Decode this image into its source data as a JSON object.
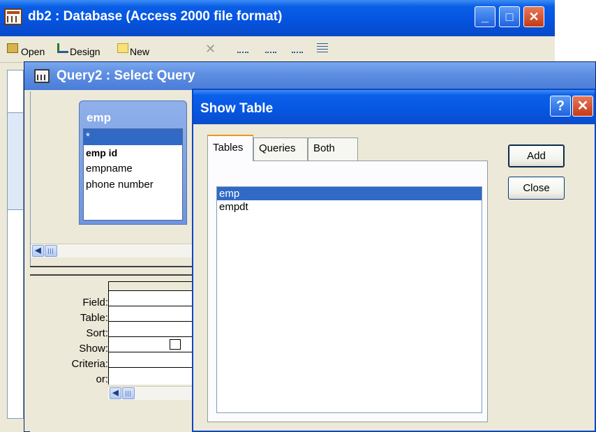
{
  "db_window": {
    "title": "db2 : Database (Access 2000 file format)",
    "toolbar": {
      "open_label": "Open",
      "design_label": "Design",
      "new_label": "New"
    }
  },
  "query_window": {
    "title": "Query2 : Select Query",
    "field_list": {
      "title": "emp",
      "fields": [
        "*",
        "emp id",
        "empname",
        "phone number"
      ]
    },
    "grid_rows": [
      "Field:",
      "Table:",
      "Sort:",
      "Show:",
      "Criteria:",
      "or:"
    ]
  },
  "show_table_dialog": {
    "title": "Show Table",
    "help_glyph": "?",
    "tabs": [
      "Tables",
      "Queries",
      "Both"
    ],
    "tables": [
      "emp",
      "empdt"
    ],
    "add_label": "Add",
    "close_label": "Close"
  },
  "colors": {
    "title_blue": "#0554e0",
    "selection": "#316ac5",
    "face": "#ece9d8"
  }
}
